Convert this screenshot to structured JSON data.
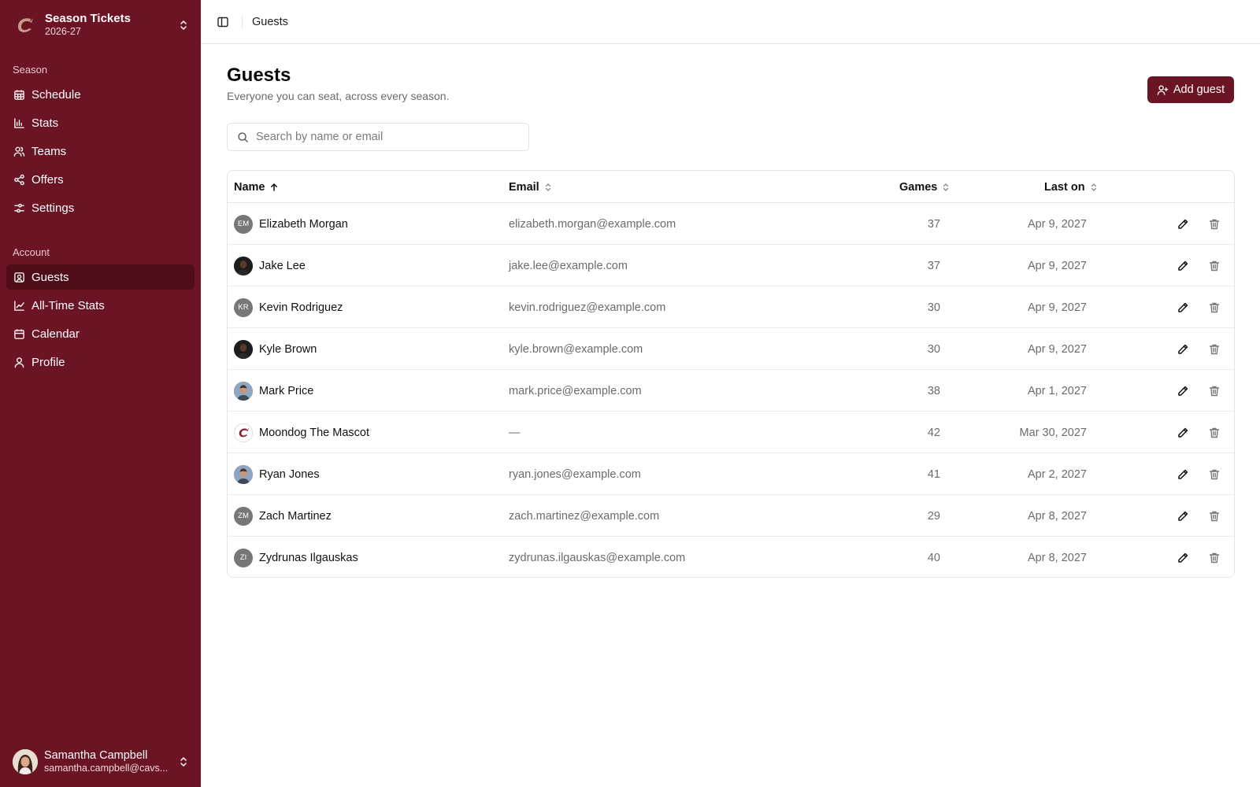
{
  "colors": {
    "sidebar_bg": "#6b1424",
    "sidebar_active": "#4f0d19",
    "accent": "#6b1424"
  },
  "sidebar": {
    "team": {
      "name": "Season Tickets",
      "season": "2026-27",
      "logo_icon": "cavs-c-logo"
    },
    "sections": [
      {
        "label": "Season",
        "items": [
          {
            "label": "Schedule",
            "icon": "calendar-grid-icon"
          },
          {
            "label": "Stats",
            "icon": "bar-chart-icon"
          },
          {
            "label": "Teams",
            "icon": "users-icon"
          },
          {
            "label": "Offers",
            "icon": "share-icon"
          },
          {
            "label": "Settings",
            "icon": "sliders-icon"
          }
        ]
      },
      {
        "label": "Account",
        "items": [
          {
            "label": "Guests",
            "icon": "contact-icon",
            "active": true
          },
          {
            "label": "All-Time Stats",
            "icon": "line-chart-icon"
          },
          {
            "label": "Calendar",
            "icon": "calendar-icon"
          },
          {
            "label": "Profile",
            "icon": "user-icon"
          }
        ]
      }
    ],
    "user": {
      "name": "Samantha Campbell",
      "email": "samantha.campbell@cavs..."
    }
  },
  "topbar": {
    "breadcrumb": "Guests"
  },
  "main": {
    "title": "Guests",
    "subtitle": "Everyone you can seat, across every season.",
    "add_button": "Add guest",
    "search_placeholder": "Search by name or email"
  },
  "table": {
    "headers": {
      "name": "Name",
      "email": "Email",
      "games": "Games",
      "last_on": "Last on"
    },
    "sort": {
      "column": "Name",
      "direction": "ascending"
    },
    "rows": [
      {
        "name": "Elizabeth Morgan",
        "initials": "EM",
        "avatar": "initials",
        "email": "elizabeth.morgan@example.com",
        "games": "37",
        "last_on": "Apr 9, 2027"
      },
      {
        "name": "Jake Lee",
        "initials": "",
        "avatar": "photo-dark",
        "email": "jake.lee@example.com",
        "games": "37",
        "last_on": "Apr 9, 2027"
      },
      {
        "name": "Kevin Rodriguez",
        "initials": "KR",
        "avatar": "initials",
        "email": "kevin.rodriguez@example.com",
        "games": "30",
        "last_on": "Apr 9, 2027"
      },
      {
        "name": "Kyle Brown",
        "initials": "",
        "avatar": "photo-dark",
        "email": "kyle.brown@example.com",
        "games": "30",
        "last_on": "Apr 9, 2027"
      },
      {
        "name": "Mark Price",
        "initials": "",
        "avatar": "photo-light",
        "email": "mark.price@example.com",
        "games": "38",
        "last_on": "Apr 1, 2027"
      },
      {
        "name": "Moondog The Mascot",
        "initials": "",
        "avatar": "logo",
        "email": "—",
        "games": "42",
        "last_on": "Mar 30, 2027"
      },
      {
        "name": "Ryan Jones",
        "initials": "",
        "avatar": "photo-light",
        "email": "ryan.jones@example.com",
        "games": "41",
        "last_on": "Apr 2, 2027"
      },
      {
        "name": "Zach Martinez",
        "initials": "ZM",
        "avatar": "initials",
        "email": "zach.martinez@example.com",
        "games": "29",
        "last_on": "Apr 8, 2027"
      },
      {
        "name": "Zydrunas Ilgauskas",
        "initials": "ZI",
        "avatar": "initials",
        "email": "zydrunas.ilgauskas@example.com",
        "games": "40",
        "last_on": "Apr 8, 2027"
      }
    ]
  }
}
